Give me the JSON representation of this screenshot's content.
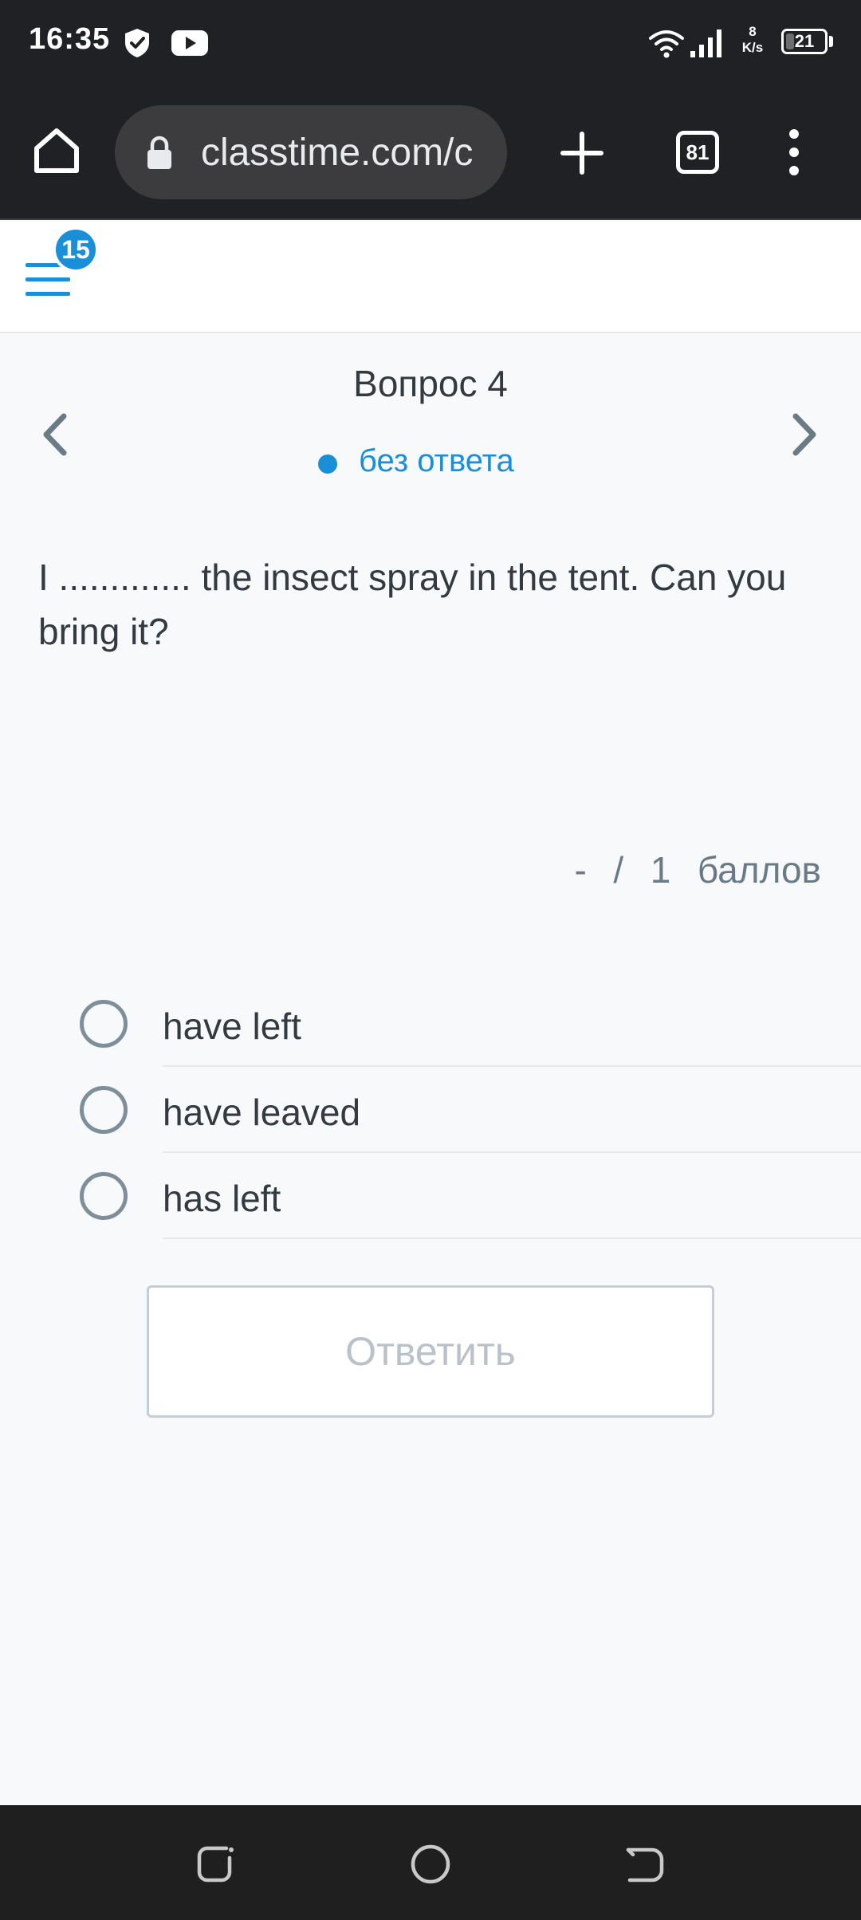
{
  "status_bar": {
    "time": "16:35",
    "speed_value": "8",
    "speed_unit": "K/s",
    "battery_level": "21",
    "battery_fraction": 0.21,
    "icons": [
      "shield-icon",
      "youtube-icon",
      "wifi-icon",
      "signal-icon",
      "battery-icon"
    ]
  },
  "browser": {
    "url": "classtime.com/c",
    "tab_count": "81",
    "icons": [
      "home-icon",
      "lock-icon",
      "plus-icon",
      "tabs-icon",
      "more-vert-icon"
    ]
  },
  "header": {
    "notification_count": "15",
    "icons": [
      "hamburger-menu-icon"
    ]
  },
  "question": {
    "title": "Вопрос 4",
    "status": "без ответа",
    "text": "I ............. the insect spray in the tent. Can you bring it?",
    "score": "-  /  1  баллов"
  },
  "options": [
    {
      "label": "have left"
    },
    {
      "label": "have leaved"
    },
    {
      "label": "has left"
    }
  ],
  "submit": {
    "label": "Ответить"
  },
  "colors": {
    "accent": "#1a8fd8",
    "text": "#333a40",
    "muted": "#7f8f99",
    "page_background": "#f7f9fb",
    "system_bar": "#202124"
  },
  "nav_bar": {
    "icons": [
      "recent-apps-icon",
      "home-circle-icon",
      "back-icon"
    ]
  }
}
